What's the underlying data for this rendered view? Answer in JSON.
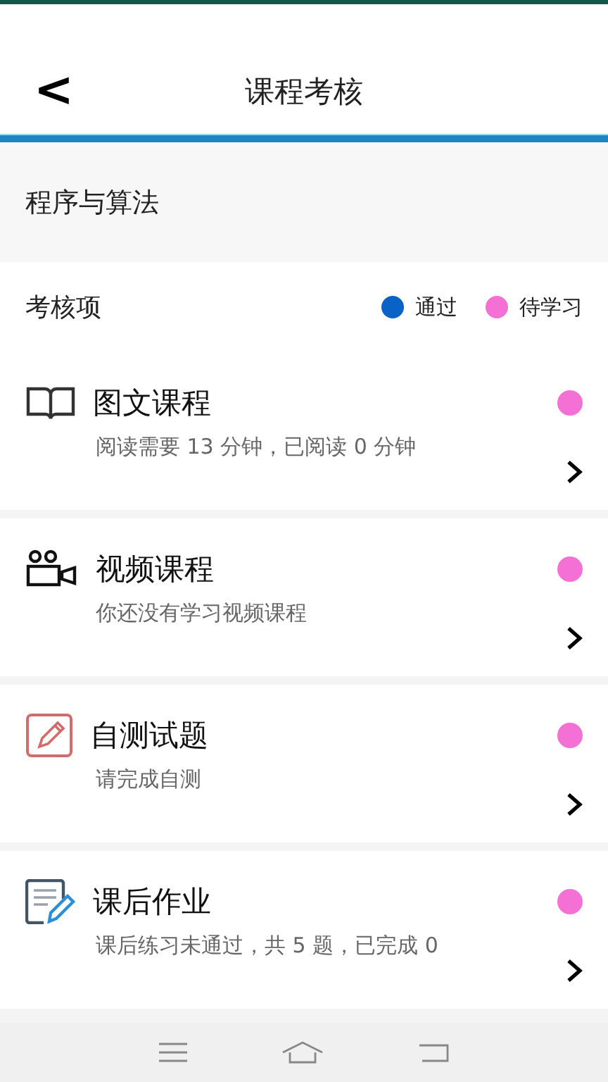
{
  "header": {
    "back_icon": "<",
    "title": "课程考核"
  },
  "course": {
    "name": "程序与算法"
  },
  "section": {
    "title": "考核项",
    "legend": [
      {
        "label": "通过",
        "color": "#0a62c6"
      },
      {
        "label": "待学习",
        "color": "#f570d4"
      }
    ]
  },
  "items": [
    {
      "kind": "book",
      "title": "图文课程",
      "desc": "阅读需要 13 分钟，已阅读 0 分钟",
      "color": "#f570d4"
    },
    {
      "kind": "video",
      "title": "视频课程",
      "desc": "你还没有学习视频课程",
      "color": "#f570d4"
    },
    {
      "kind": "test",
      "title": "自测试题",
      "desc": "请完成自测",
      "color": "#f570d4"
    },
    {
      "kind": "homework",
      "title": "课后作业",
      "desc": "课后练习未通过，共 5 题，已完成 0",
      "color": "#f570d4"
    }
  ]
}
